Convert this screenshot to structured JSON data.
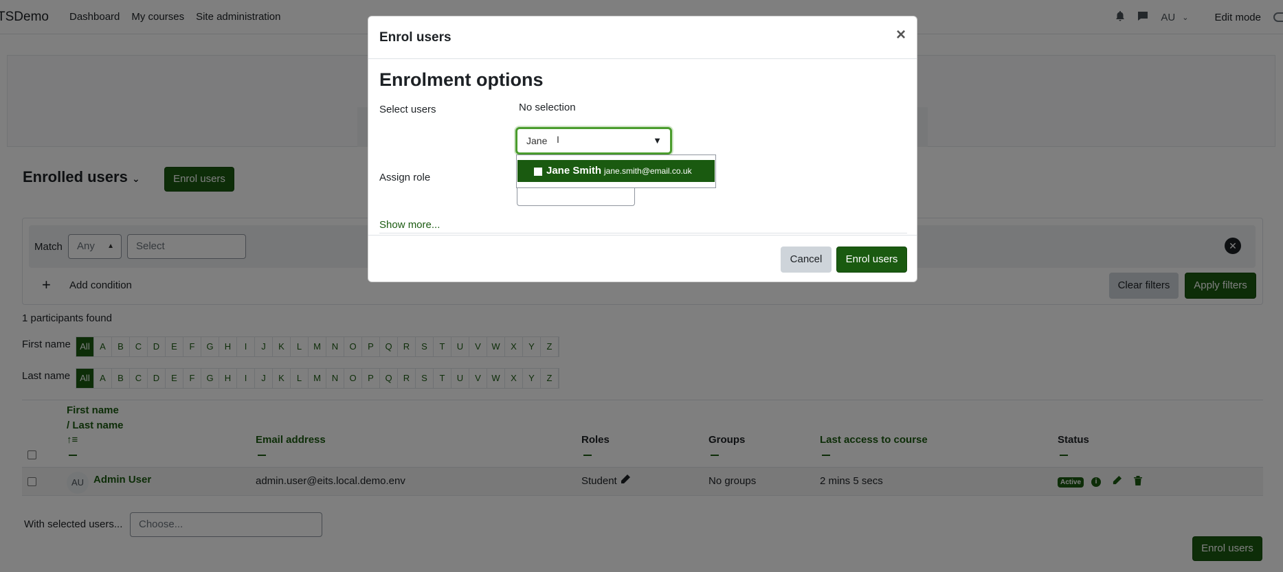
{
  "navbar": {
    "brand": "TSDemo",
    "links": [
      "Dashboard",
      "My courses",
      "Site administration"
    ],
    "user_initials": "AU",
    "edit_mode": "Edit mode"
  },
  "page": {
    "title": "Enrolled users",
    "enrol_button": "Enrol users",
    "filters": {
      "match_label": "Match",
      "match_value": "Any",
      "select_value": "Select",
      "add_condition": "Add condition",
      "clear_filters": "Clear filters",
      "apply_filters": "Apply filters"
    },
    "participants_found": "1 participants found",
    "first_name_label": "First name",
    "last_name_label": "Last name",
    "alphabet": [
      "All",
      "A",
      "B",
      "C",
      "D",
      "E",
      "F",
      "G",
      "H",
      "I",
      "J",
      "K",
      "L",
      "M",
      "N",
      "O",
      "P",
      "Q",
      "R",
      "S",
      "T",
      "U",
      "V",
      "W",
      "X",
      "Y",
      "Z"
    ],
    "table": {
      "headers": {
        "first_name": "First name",
        "last_name": "/ Last name",
        "email": "Email address",
        "roles": "Roles",
        "groups": "Groups",
        "last_access": "Last access to course",
        "status": "Status"
      },
      "rows": [
        {
          "initials": "AU",
          "name": "Admin User",
          "email": "admin.user@eits.local.demo.env",
          "role": "Student",
          "groups": "No groups",
          "last_access": "2 mins 5 secs",
          "status": "Active"
        }
      ]
    },
    "with_selected_label": "With selected users...",
    "with_selected_placeholder": "Choose...",
    "enrol_button_bottom": "Enrol users"
  },
  "modal": {
    "title": "Enrol users",
    "close": "×",
    "section_title": "Enrolment options",
    "select_users_label": "Select users",
    "no_selection": "No selection",
    "search_value": "Jane",
    "suggestion_name": "Jane Smith",
    "suggestion_email": "jane.smith@email.co.uk",
    "assign_role_label": "Assign role",
    "show_more": "Show more...",
    "cancel": "Cancel",
    "submit": "Enrol users"
  },
  "colors": {
    "primary": "#1a5a10",
    "focus": "#4a9c2d"
  }
}
